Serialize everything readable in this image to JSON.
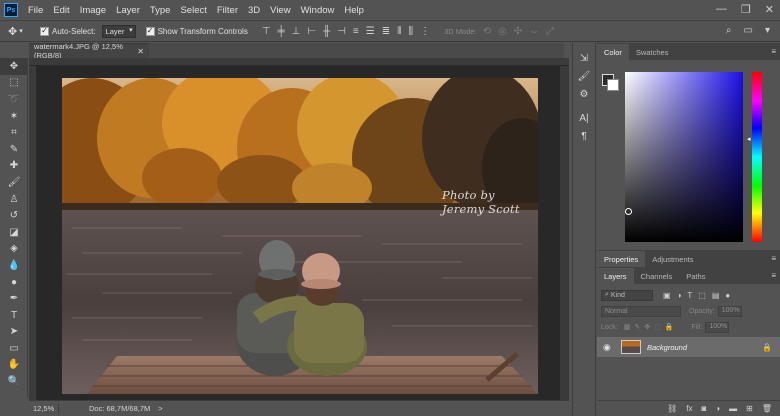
{
  "app": {
    "logo": "Ps"
  },
  "menu": [
    "File",
    "Edit",
    "Image",
    "Layer",
    "Type",
    "Select",
    "Filter",
    "3D",
    "View",
    "Window",
    "Help"
  ],
  "window_controls": {
    "minimize": "—",
    "restore": "❐",
    "close": "✕"
  },
  "options_bar": {
    "auto_select_label": "Auto-Select:",
    "auto_select_checked": true,
    "auto_select_value": "Layer",
    "show_transform_label": "Show Transform Controls",
    "show_transform_checked": true,
    "mode_3d_label": "3D Mode:"
  },
  "document": {
    "tab_title": "watermark4.JPG @ 12,5% (RGB/8)",
    "watermark_text": "Photo by Jeremy Scott"
  },
  "status": {
    "zoom": "12,5%",
    "doc_size": "Doc: 68,7M/68,7M",
    "arrow": ">"
  },
  "color_panel": {
    "tabs": [
      "Color",
      "Swatches"
    ],
    "active_tab": "Color",
    "foreground": "#2c2c2c",
    "background": "#ffffff"
  },
  "properties_panel": {
    "tabs": [
      "Properties",
      "Adjustments"
    ]
  },
  "layers_panel": {
    "tabs": [
      "Layers",
      "Channels",
      "Paths"
    ],
    "kind_label": "Kind",
    "blend_mode": "Normal",
    "opacity_label": "Opacity:",
    "opacity_value": "100%",
    "lock_label": "Lock:",
    "fill_label": "Fill:",
    "fill_value": "100%",
    "layers": [
      {
        "name": "Background",
        "visible": true,
        "locked": true
      }
    ]
  }
}
